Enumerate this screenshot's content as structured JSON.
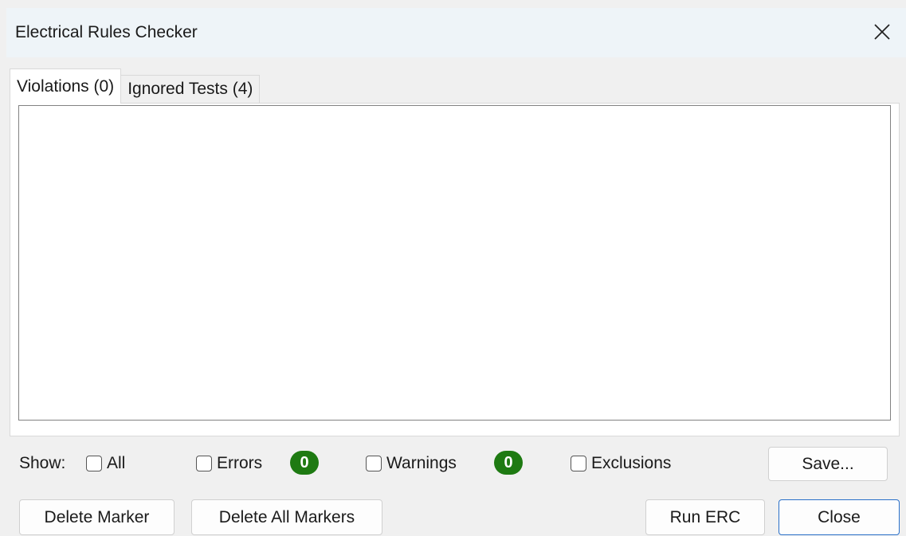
{
  "dialog": {
    "title": "Electrical Rules Checker"
  },
  "tabs": [
    {
      "label": "Violations (0)",
      "active": true
    },
    {
      "label": "Ignored Tests (4)",
      "active": false
    }
  ],
  "filters": {
    "show_label": "Show:",
    "all_label": "All",
    "errors_label": "Errors",
    "errors_count": "0",
    "warnings_label": "Warnings",
    "warnings_count": "0",
    "exclusions_label": "Exclusions"
  },
  "buttons": {
    "save": "Save...",
    "delete_marker": "Delete Marker",
    "delete_all_markers": "Delete All Markers",
    "run_erc": "Run ERC",
    "close": "Close"
  },
  "colors": {
    "badge": "#1e7a12",
    "default_button_border": "#2a70c9",
    "titlebar": "#eef4f8"
  }
}
